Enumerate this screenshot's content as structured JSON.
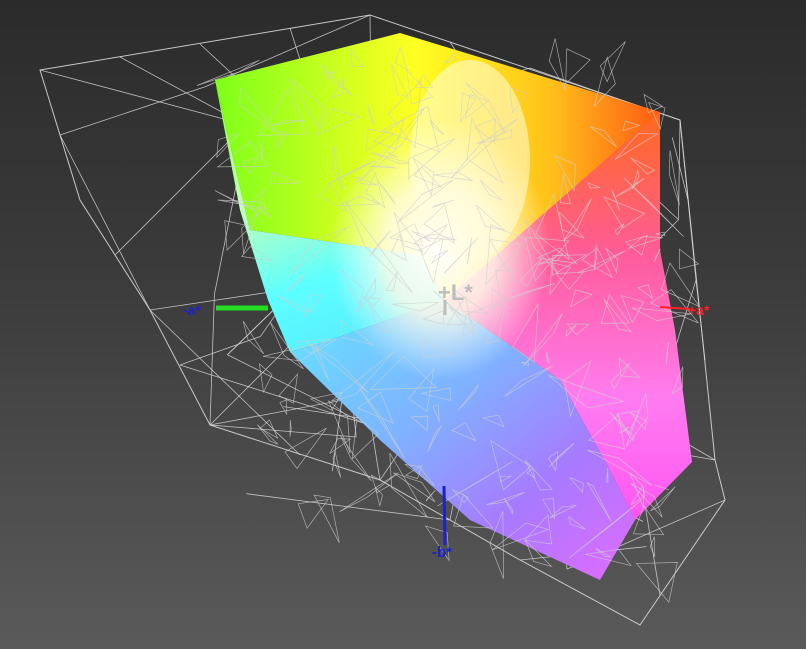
{
  "gamut_view": {
    "axis_labels": {
      "plus_L": "+L*",
      "minus_a": "-a*",
      "plus_a": "+a*",
      "minus_b": "-b*"
    },
    "colors": {
      "background_top": "#2b2b2b",
      "background_bottom": "#5a5a5a",
      "wireframe": "#d8d8d8",
      "axis_a_negative": "#22dd22",
      "axis_a_positive": "#ff2222",
      "axis_b_negative": "#1a22cc",
      "axis_L": "#bdbdbd"
    }
  }
}
